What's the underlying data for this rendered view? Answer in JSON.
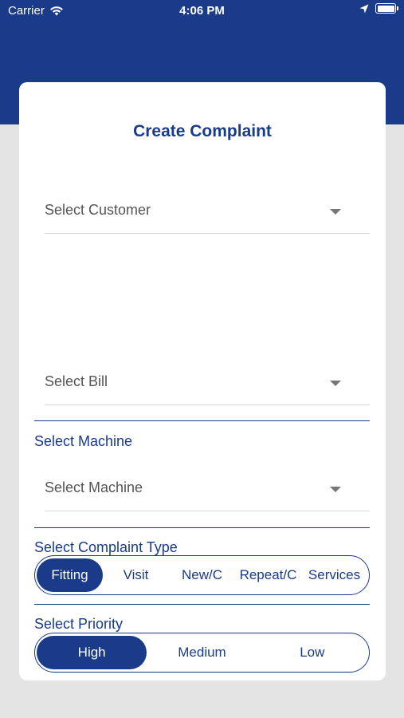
{
  "status": {
    "carrier": "Carrier",
    "time": "4:06 PM"
  },
  "form": {
    "title": "Create Complaint",
    "customer_placeholder": "Select Customer",
    "bill_placeholder": "Select Bill",
    "machine_label": "Select Machine",
    "machine_placeholder": "Select Machine",
    "complaint_type_label": "Select Complaint Type",
    "complaint_types": [
      "Fitting",
      "Visit",
      "New/C",
      "Repeat/C",
      "Services"
    ],
    "selected_complaint_type": "Fitting",
    "priority_label": "Select Priority",
    "priorities": [
      "High",
      "Medium",
      "Low"
    ],
    "selected_priority": "High"
  },
  "colors": {
    "primary": "#1a3a8a",
    "background": "#e4e4e4",
    "card": "#ffffff"
  }
}
